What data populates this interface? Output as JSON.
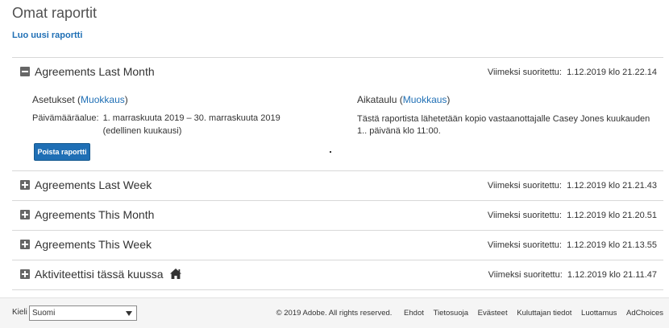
{
  "page": {
    "title": "Omat raportit",
    "create_link": "Luo uusi raportti"
  },
  "colors": {
    "link": "#1f6fb5",
    "button": "#1f6fb5",
    "footer_bg": "#f5f5f5",
    "divider": "#d8d8d8"
  },
  "reports": [
    {
      "name": "Agreements Last Month",
      "expanded": true,
      "last_run_label": "Viimeksi suoritettu:",
      "last_run": "1.12.2019 klo 21.22.14",
      "details": {
        "settings_heading": "Asetukset",
        "settings_edit": "Muokkaus",
        "date_range_label": "Päivämääräalue:",
        "date_range_value": "1. marraskuuta 2019 – 30. marraskuuta 2019 (edellinen kuukausi)",
        "schedule_heading": "Aikataulu",
        "schedule_edit": "Muokkaus",
        "schedule_text": "Tästä raportista lähetetään kopio vastaanottajalle Casey Jones kuukauden 1.. päivänä klo 11:00.",
        "delete_button": "Poista raportti",
        "dot": "."
      }
    },
    {
      "name": "Agreements Last Week",
      "expanded": false,
      "last_run_label": "Viimeksi suoritettu:",
      "last_run": "1.12.2019 klo 21.21.43"
    },
    {
      "name": "Agreements This Month",
      "expanded": false,
      "last_run_label": "Viimeksi suoritettu:",
      "last_run": "1.12.2019 klo 21.20.51"
    },
    {
      "name": "Agreements This Week",
      "expanded": false,
      "last_run_label": "Viimeksi suoritettu:",
      "last_run": "1.12.2019 klo 21.13.55"
    },
    {
      "name": "Aktiviteettisi tässä kuussa",
      "expanded": false,
      "has_home_icon": true,
      "home_icon": "home-icon",
      "last_run_label": "Viimeksi suoritettu:",
      "last_run": "1.12.2019 klo 21.11.47"
    }
  ],
  "footer": {
    "language_label": "Kieli",
    "language_value": "Suomi",
    "copyright": "© 2019 Adobe. All rights reserved.",
    "links": [
      "Ehdot",
      "Tietosuoja",
      "Evästeet",
      "Kuluttajan tiedot",
      "Luottamus",
      "AdChoices"
    ]
  }
}
